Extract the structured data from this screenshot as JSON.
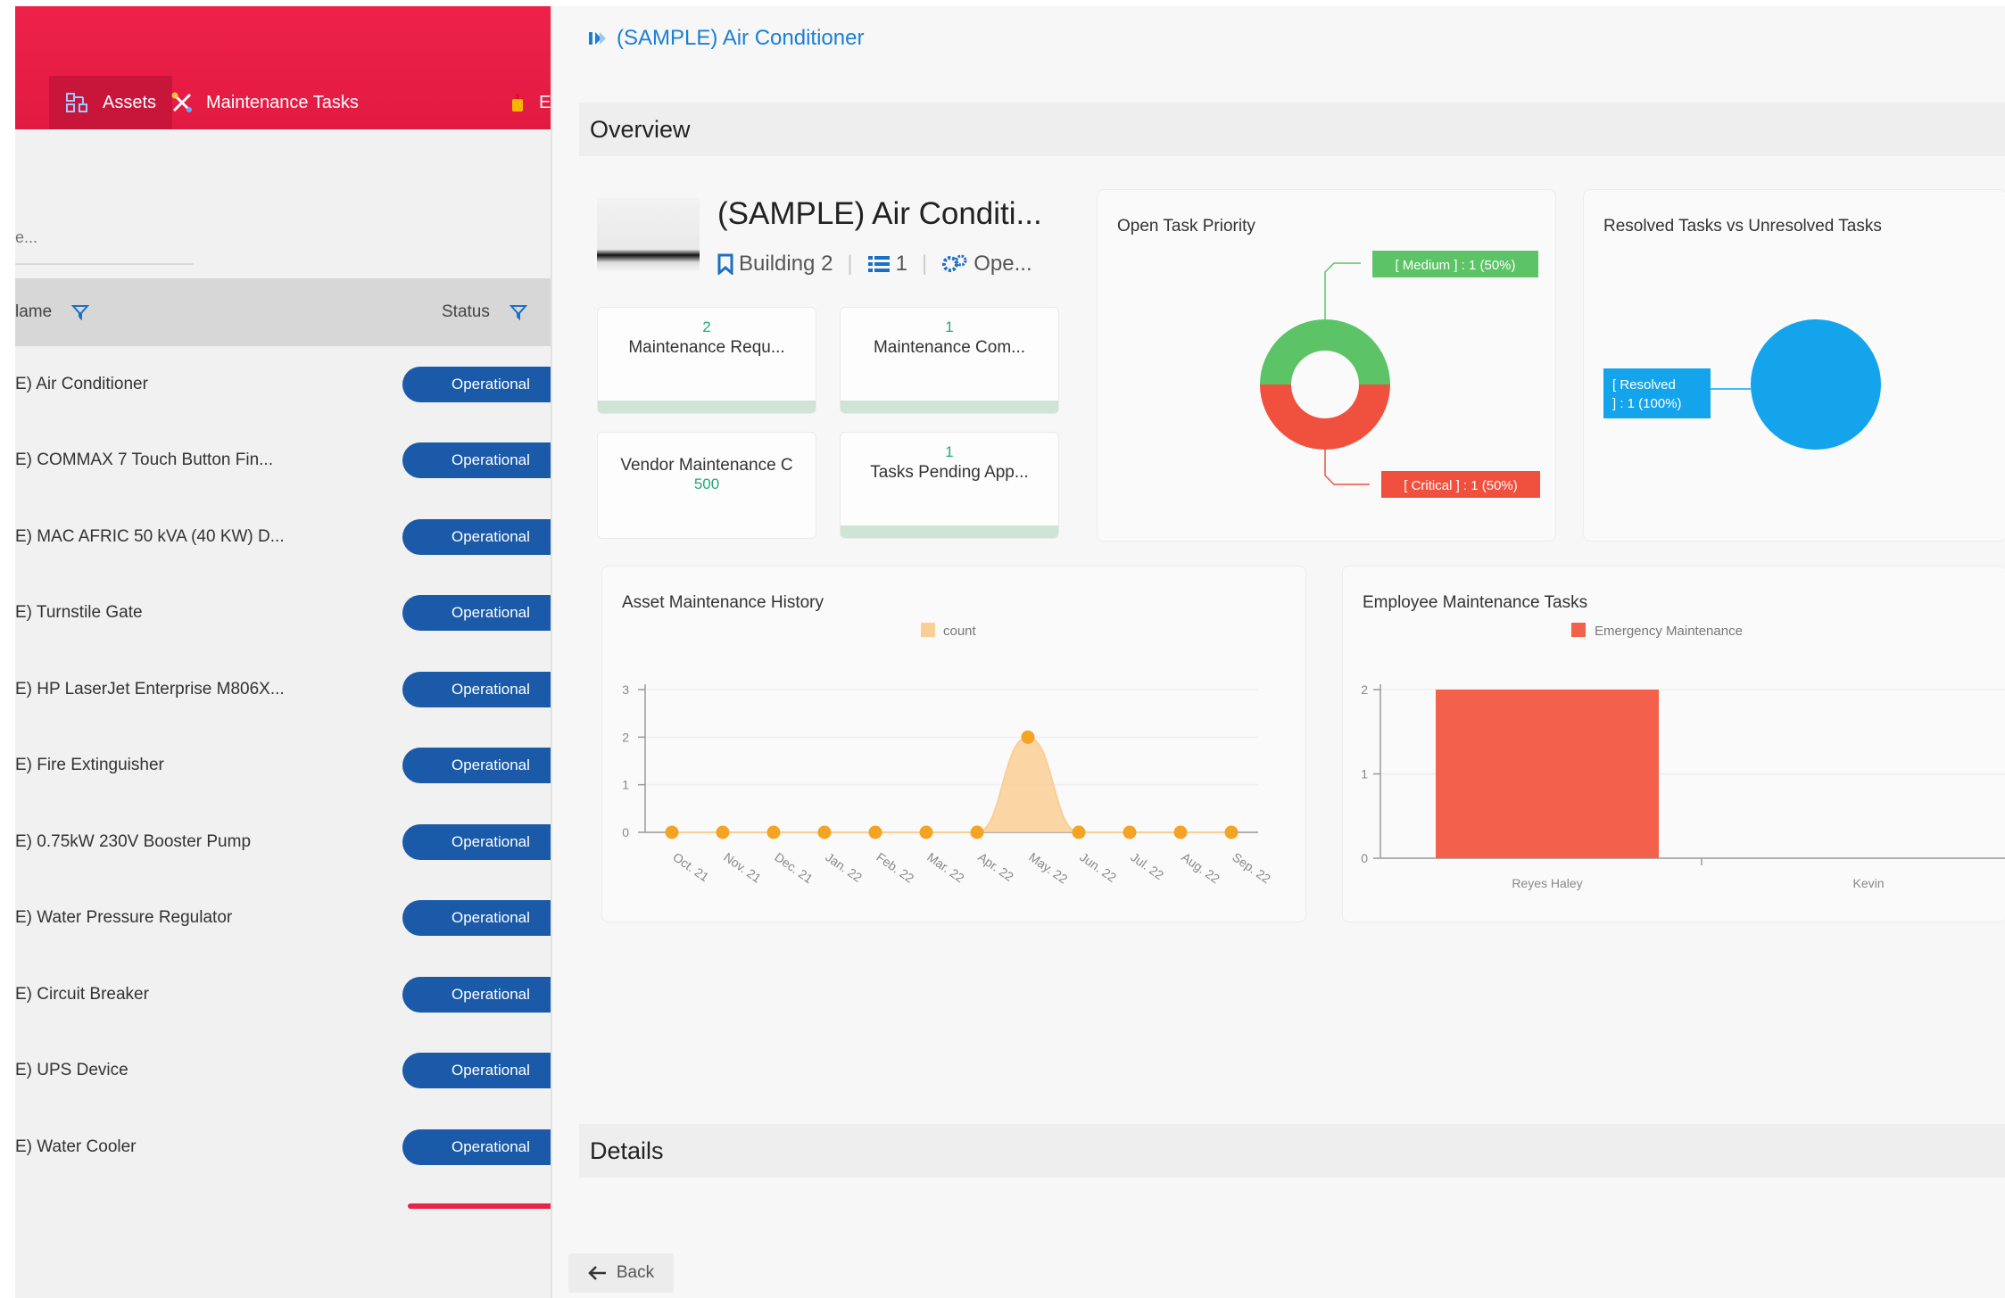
{
  "nav": {
    "tabs": [
      {
        "label": "Assets",
        "icon": "assets-icon",
        "active": true
      },
      {
        "label": "Maintenance Tasks",
        "icon": "tools-icon",
        "active": false
      },
      {
        "label": "Em",
        "icon": "emergency-icon",
        "active": false
      }
    ]
  },
  "left": {
    "filter_text": "e...",
    "columns": {
      "name": "lame",
      "status": "Status"
    },
    "rows": [
      {
        "name": "E) Air Conditioner",
        "status": "Operational"
      },
      {
        "name": "E) COMMAX 7 Touch Button Fin...",
        "status": "Operational"
      },
      {
        "name": "E) MAC AFRIC 50 kVA (40 KW) D...",
        "status": "Operational"
      },
      {
        "name": "E) Turnstile Gate",
        "status": "Operational"
      },
      {
        "name": "E) HP LaserJet Enterprise M806X...",
        "status": "Operational"
      },
      {
        "name": "E) Fire Extinguisher",
        "status": "Operational"
      },
      {
        "name": "E) 0.75kW 230V Booster Pump",
        "status": "Operational"
      },
      {
        "name": "E) Water Pressure Regulator",
        "status": "Operational"
      },
      {
        "name": "E) Circuit Breaker",
        "status": "Operational"
      },
      {
        "name": "E) UPS Device",
        "status": "Operational"
      },
      {
        "name": "E) Water Cooler",
        "status": "Operational"
      }
    ],
    "status_color": "#1a5aa8"
  },
  "right": {
    "breadcrumb": "(SAMPLE) Air Conditioner",
    "overview_title": "Overview",
    "details_title": "Details",
    "back_label": "Back",
    "asset": {
      "title": "(SAMPLE) Air Conditi...",
      "location": "Building 2",
      "count": "1",
      "status": "Ope..."
    },
    "stats": [
      {
        "num": "2",
        "label": "Maintenance Requ..."
      },
      {
        "num": "1",
        "label": "Maintenance Com..."
      },
      {
        "num": "500",
        "label": "Vendor Maintenance C"
      },
      {
        "num": "1",
        "label": "Tasks Pending App..."
      }
    ]
  },
  "chart_data": [
    {
      "type": "pie",
      "title": "Open Task Priority",
      "slices": [
        {
          "name": "Medium",
          "value": 1,
          "label": "[ Medium ] : 1 (50%)",
          "color": "#5cc466"
        },
        {
          "name": "Critical",
          "value": 1,
          "label": "[ Critical ] : 1 (50%)",
          "color": "#f0513f"
        }
      ]
    },
    {
      "type": "pie",
      "title": "Resolved Tasks vs Unresolved Tasks",
      "slices": [
        {
          "name": "Resolved",
          "value": 1,
          "label_lines": [
            "[ Resolved",
            "] : 1 (100%)"
          ],
          "color": "#13a4ec"
        }
      ]
    },
    {
      "type": "area",
      "title": "Asset Maintenance History",
      "legend": "count",
      "categories": [
        "Oct. 21",
        "Nov. 21",
        "Dec. 21",
        "Jan. 22",
        "Feb. 22",
        "Mar. 22",
        "Apr. 22",
        "May. 22",
        "Jun. 22",
        "Jul. 22",
        "Aug. 22",
        "Sep. 22"
      ],
      "values": [
        0,
        0,
        0,
        0,
        0,
        0,
        0,
        2,
        0,
        0,
        0,
        0
      ],
      "ylim": [
        0,
        3
      ],
      "yticks": [
        0,
        1,
        2,
        3
      ],
      "line_color": "#f4a323",
      "fill_color": "#f9cf95"
    },
    {
      "type": "bar",
      "title": "Employee Maintenance Tasks",
      "legend": "Emergency Maintenance",
      "categories": [
        "Reyes Haley",
        "Kevin"
      ],
      "values": [
        2,
        0
      ],
      "ylim": [
        0,
        2
      ],
      "yticks": [
        0,
        1,
        2
      ],
      "color": "#f3604b"
    }
  ]
}
